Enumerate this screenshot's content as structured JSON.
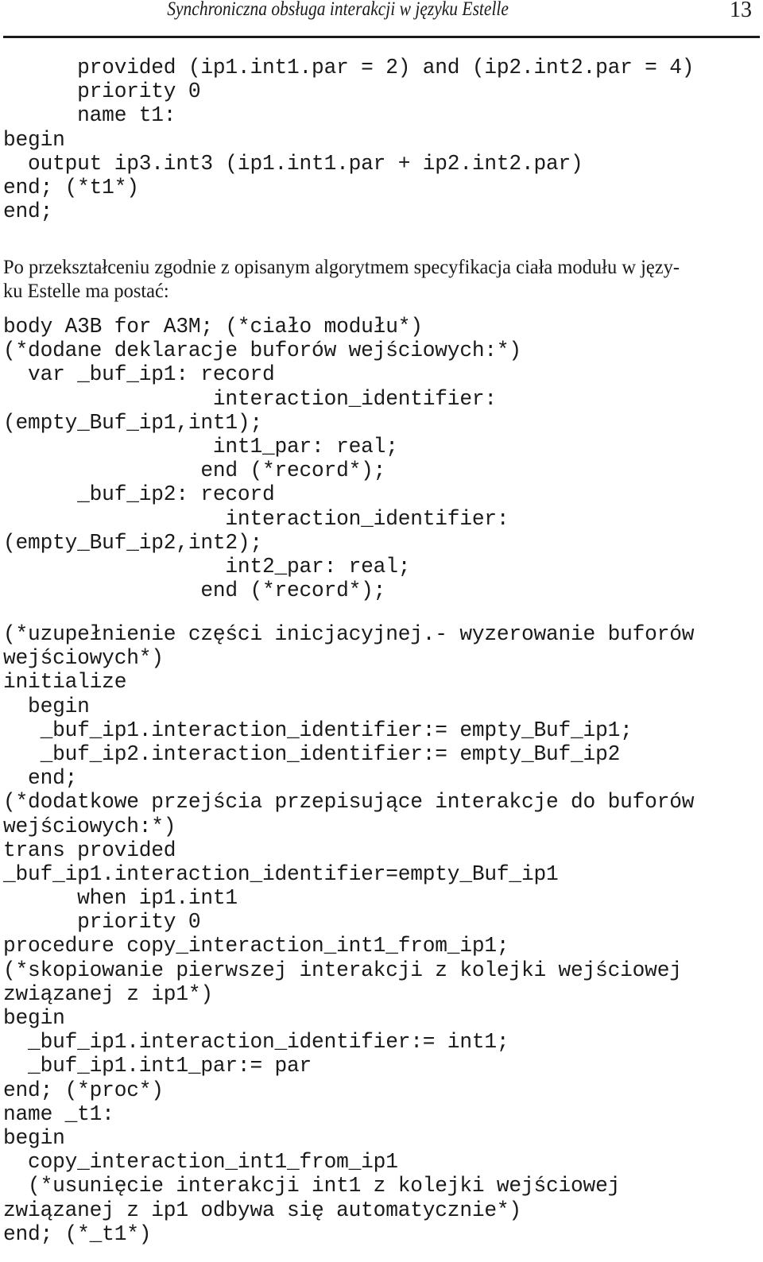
{
  "header": {
    "title": "Synchroniczna obsługa interakcji w języku Estelle",
    "page_number": "13"
  },
  "code_block_1": [
    "      provided (ip1.int1.par = 2) and (ip2.int2.par = 4)",
    "      priority 0",
    "      name t1:",
    "begin",
    "  output ip3.int3 (ip1.int1.par + ip2.int2.par)",
    "end; (*t1*)",
    "end;"
  ],
  "paragraph": [
    "Po przekształceniu zgodnie z opisanym algorytmem specyfikacja ciała modułu w języ-",
    "ku Estelle ma postać:"
  ],
  "code_block_2": [
    "body A3B for A3M; (*ciało modułu*)",
    "(*dodane deklaracje buforów wejściowych:*)",
    "  var _buf_ip1: record",
    "                 interaction_identifier:",
    "(empty_Buf_ip1,int1);",
    "                 int1_par: real;",
    "                end (*record*);",
    "      _buf_ip2: record",
    "                  interaction_identifier:",
    "(empty_Buf_ip2,int2);",
    "                  int2_par: real;",
    "                end (*record*);"
  ],
  "code_block_3": [
    "(*uzupełnienie części inicjacyjnej.- wyzerowanie buforów",
    "wejściowych*)",
    "initialize",
    "  begin",
    "   _buf_ip1.interaction_identifier:= empty_Buf_ip1;",
    "   _buf_ip2.interaction_identifier:= empty_Buf_ip2",
    "  end;",
    "(*dodatkowe przejścia przepisujące interakcje do buforów",
    "wejściowych:*)",
    "trans provided",
    "_buf_ip1.interaction_identifier=empty_Buf_ip1",
    "      when ip1.int1",
    "      priority 0",
    "procedure copy_interaction_int1_from_ip1;",
    "(*skopiowanie pierwszej interakcji z kolejki wejściowej",
    "związanej z ip1*)",
    "begin",
    "  _buf_ip1.interaction_identifier:= int1;",
    "  _buf_ip1.int1_par:= par",
    "end; (*proc*)",
    "name _t1:",
    "begin",
    "  copy_interaction_int1_from_ip1",
    "  (*usunięcie interakcji int1 z kolejki wejściowej",
    "związanej z ip1 odbywa się automatycznie*)",
    "end; (*_t1*)"
  ]
}
